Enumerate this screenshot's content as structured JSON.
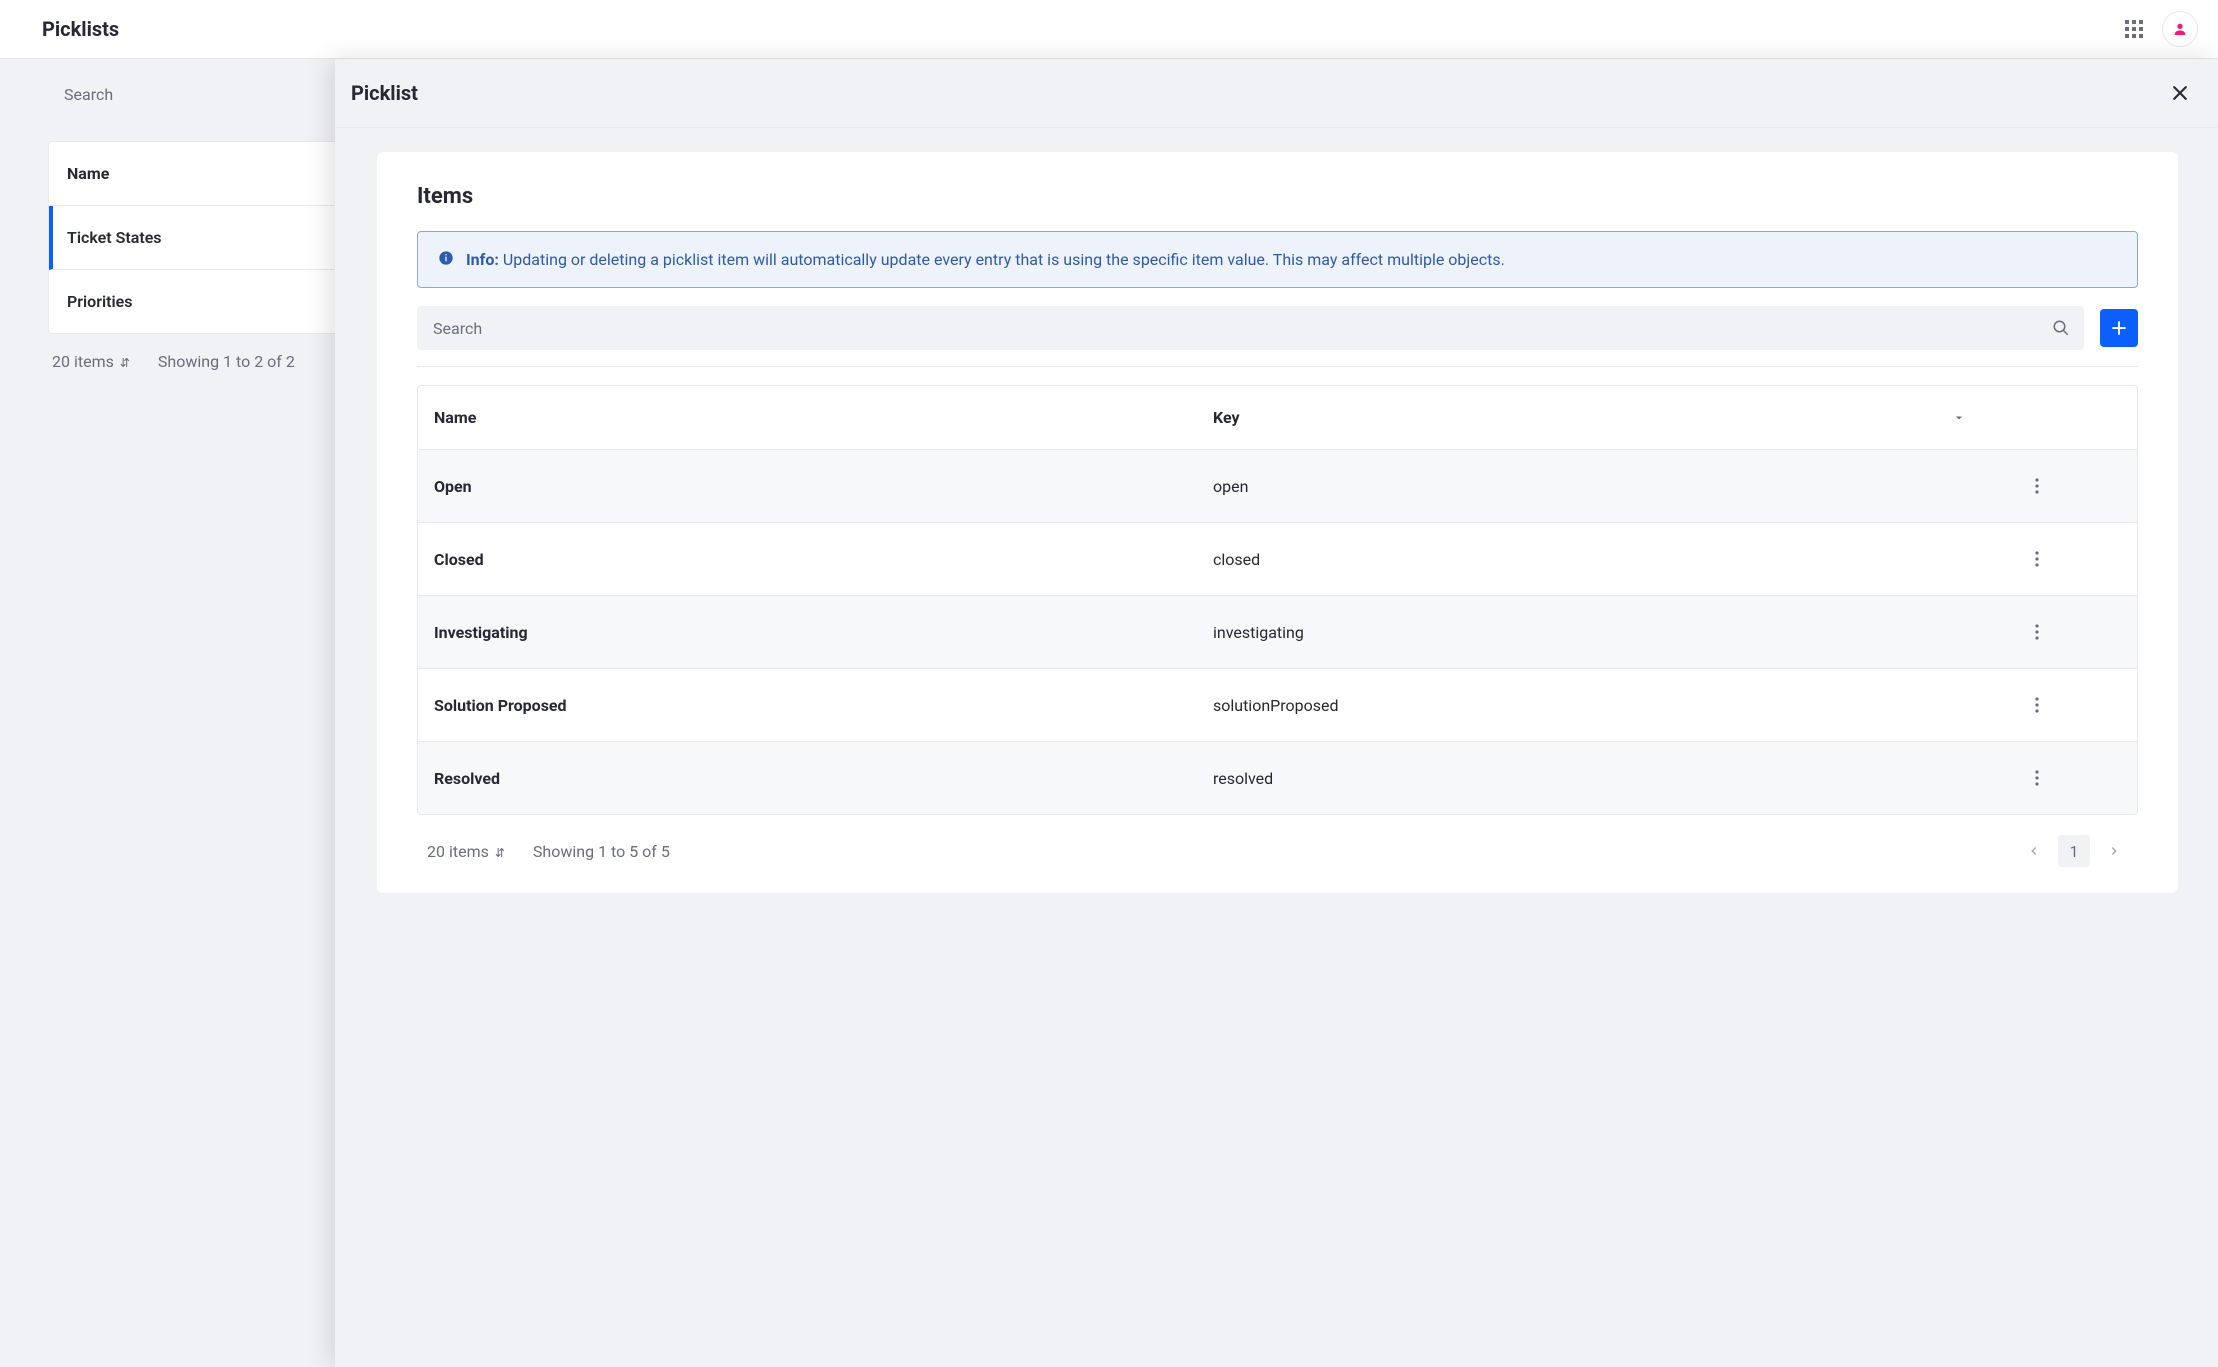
{
  "header": {
    "title": "Picklists"
  },
  "index": {
    "search_placeholder": "Search",
    "column_header": "Name",
    "rows": [
      {
        "label": "Ticket States",
        "active": true
      },
      {
        "label": "Priorities",
        "active": false
      }
    ],
    "page_size_label": "20 items",
    "showing_label": "Showing 1 to 2 of 2"
  },
  "panel": {
    "title": "Picklist",
    "items": {
      "heading": "Items",
      "info_label": "Info:",
      "info_text": "Updating or deleting a picklist item will automatically update every entry that is using the specific item value. This may affect multiple objects.",
      "search_placeholder": "Search",
      "columns": {
        "name": "Name",
        "key": "Key"
      },
      "rows": [
        {
          "name": "Open",
          "key": "open"
        },
        {
          "name": "Closed",
          "key": "closed"
        },
        {
          "name": "Investigating",
          "key": "investigating"
        },
        {
          "name": "Solution Proposed",
          "key": "solutionProposed"
        },
        {
          "name": "Resolved",
          "key": "resolved"
        }
      ],
      "page_size_label": "20 items",
      "showing_label": "Showing 1 to 5 of 5",
      "current_page": "1"
    }
  }
}
